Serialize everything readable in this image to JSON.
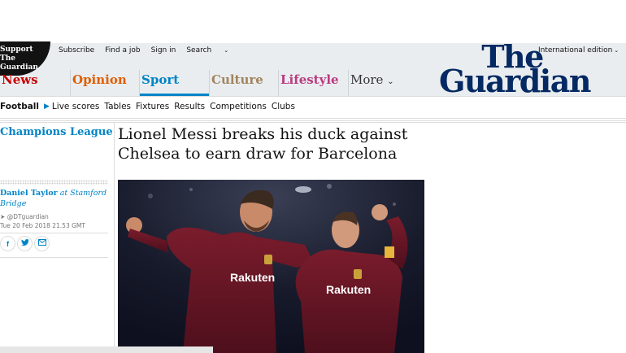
{
  "support": {
    "label": "Support The Guardian"
  },
  "toplinks": {
    "subscribe": "Subscribe",
    "find_job": "Find a job",
    "sign_in": "Sign in",
    "search": "Search"
  },
  "edition": "International edition",
  "logo": {
    "line1": "The",
    "line2": "Guardian"
  },
  "pillars": {
    "news": "News",
    "opinion": "Opinion",
    "sport": "Sport",
    "culture": "Culture",
    "lifestyle": "Lifestyle",
    "more": "More"
  },
  "subnav": {
    "section": "Football",
    "items": [
      "Live scores",
      "Tables",
      "Fixtures",
      "Results",
      "Competitions",
      "Clubs"
    ]
  },
  "article": {
    "section": "Champions League",
    "headline": "Lionel Messi breaks his duck against Chelsea to earn draw for Barcelona",
    "author": "Daniel Taylor",
    "location": "at Stamford Bridge",
    "twitter": "@DTguardian",
    "date": "Tue 20 Feb 2018 21.53 GMT",
    "photo_text_1": "Rakuten",
    "photo_text_2": "Rakuten"
  },
  "colors": {
    "news": "#c70000",
    "opinion": "#e05e00",
    "sport": "#0084c6",
    "culture": "#a1845c",
    "lifestyle": "#bb3b80",
    "brand": "#052962"
  }
}
